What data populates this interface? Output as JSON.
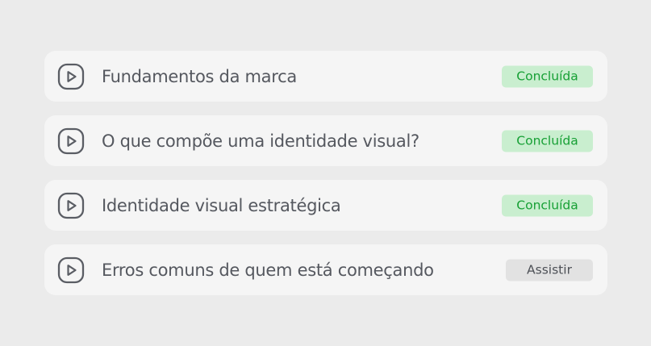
{
  "colors": {
    "background": "#ebebeb",
    "card": "#f5f5f5",
    "text": "#55585f",
    "done_bg": "#c9eecf",
    "done_text": "#17a035",
    "watch_bg": "#e2e2e2",
    "watch_text": "#4e5157"
  },
  "lessons": [
    {
      "icon": "play-icon",
      "title": "Fundamentos da marca",
      "status": "Concluída",
      "state": "done"
    },
    {
      "icon": "play-icon",
      "title": "O que compõe uma identidade visual?",
      "status": "Concluída",
      "state": "done"
    },
    {
      "icon": "play-icon",
      "title": "Identidade visual estratégica",
      "status": "Concluída",
      "state": "done"
    },
    {
      "icon": "play-icon",
      "title": "Erros comuns de quem está começando",
      "status": "Assistir",
      "state": "watch"
    }
  ]
}
